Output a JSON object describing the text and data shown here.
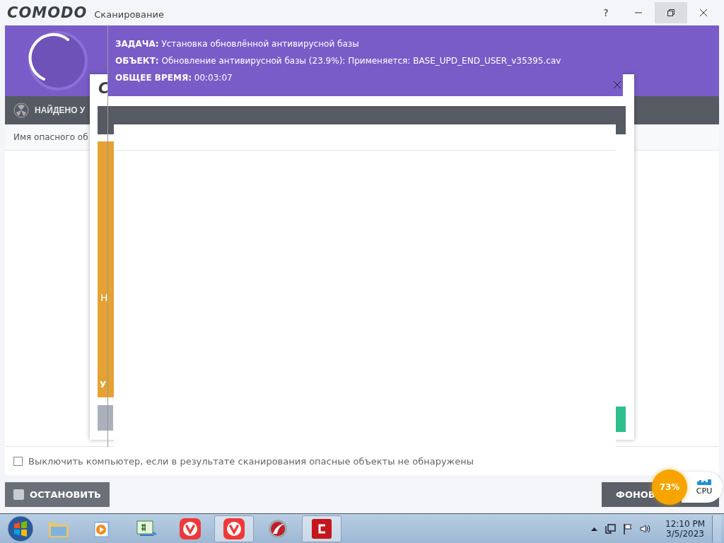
{
  "window": {
    "logo": "COMODO",
    "title": "Сканирование",
    "help": "?"
  },
  "scan": {
    "task_label": "ЗАДАЧА:",
    "task": "Установка обновлённой антивирусной базы",
    "object_label": "ОБЪЕКТ:",
    "object": "Обновление антивирусной базы (23.9%): Применяется: BASE_UPD_END_USER_v35395.cav",
    "time_label": "ОБЩЕЕ ВРЕМЯ:",
    "time": "00:03:07"
  },
  "found_bar": {
    "label": "НАЙДЕНО У"
  },
  "table": {
    "columns": [
      "Имя опасного об"
    ]
  },
  "dialog_behind": {
    "logo": "C",
    "heading": "Н",
    "footer": "У"
  },
  "shutdown_option": {
    "label": "Выключить компьютер, если в результате сканирования опасные объекты не обнаружены",
    "checked": false
  },
  "buttons": [
    {
      "label": "ОСТАНОВИТЬ",
      "kind": "stop"
    },
    {
      "label": "ФОНОВ",
      "kind": "background"
    }
  ],
  "cpu_widget": {
    "percent": "73%",
    "label": "CPU"
  },
  "taskbar": {
    "apps": [
      {
        "kind": "folder",
        "selected": false
      },
      {
        "kind": "media",
        "selected": false
      },
      {
        "kind": "csharp",
        "selected": false
      },
      {
        "kind": "vivaldi",
        "selected": false
      },
      {
        "kind": "vivaldi",
        "selected": true
      },
      {
        "kind": "comodo-dragon",
        "selected": false
      },
      {
        "kind": "comodo",
        "selected": true
      }
    ],
    "clock": {
      "time": "12:10 PM",
      "date": "3/5/2023"
    }
  }
}
